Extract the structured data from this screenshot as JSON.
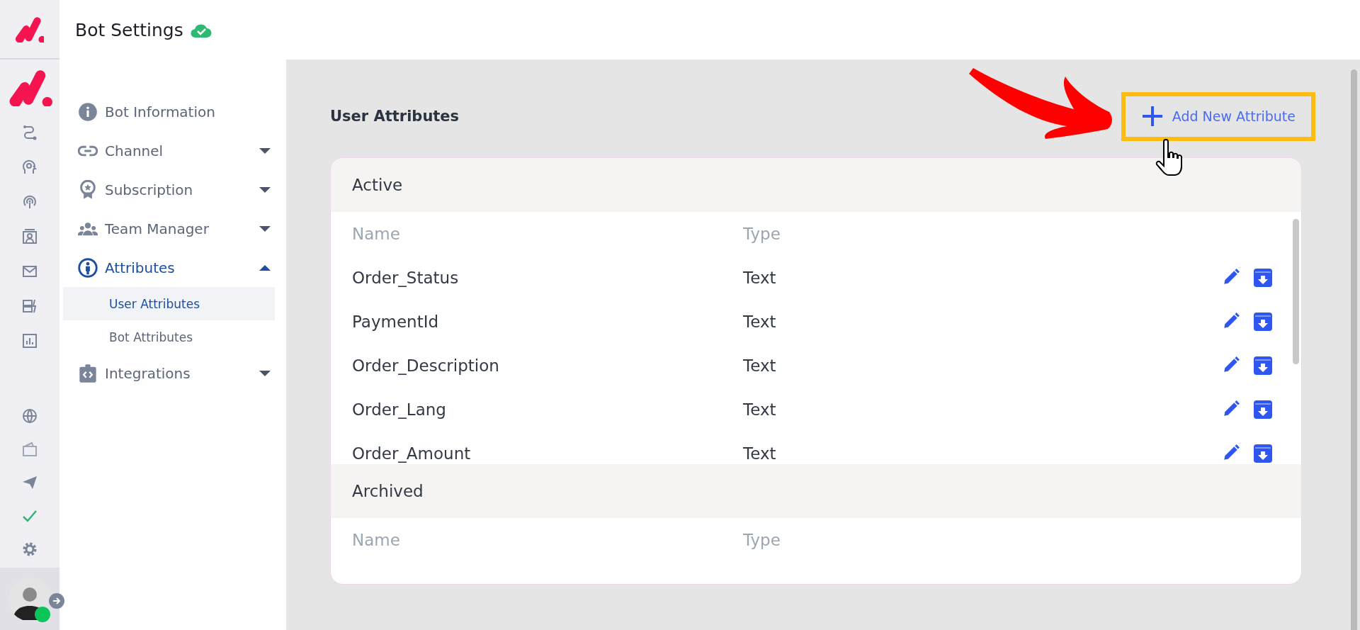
{
  "header": {
    "title": "Bot Settings"
  },
  "sidebar": {
    "items": [
      {
        "label": "Bot Information",
        "kind": "info",
        "expanded": false
      },
      {
        "label": "Channel",
        "kind": "link",
        "expanded": false
      },
      {
        "label": "Subscription",
        "kind": "badge",
        "expanded": false
      },
      {
        "label": "Team Manager",
        "kind": "team",
        "expanded": false
      },
      {
        "label": "Attributes",
        "kind": "person",
        "expanded": true,
        "children": [
          {
            "label": "User Attributes",
            "selected": true
          },
          {
            "label": "Bot Attributes",
            "selected": false
          }
        ]
      },
      {
        "label": "Integrations",
        "kind": "code",
        "expanded": false
      }
    ]
  },
  "page": {
    "title": "User Attributes",
    "add_button": {
      "label": "Add New Attribute"
    }
  },
  "sections": [
    {
      "title": "Active",
      "columns": [
        "Name",
        "Type"
      ],
      "rows": [
        {
          "name": "Order_Status",
          "type": "Text"
        },
        {
          "name": "PaymentId",
          "type": "Text"
        },
        {
          "name": "Order_Description",
          "type": "Text"
        },
        {
          "name": "Order_Lang",
          "type": "Text"
        },
        {
          "name": "Order_Amount",
          "type": "Text"
        }
      ]
    },
    {
      "title": "Archived",
      "columns": [
        "Name",
        "Type"
      ]
    }
  ]
}
